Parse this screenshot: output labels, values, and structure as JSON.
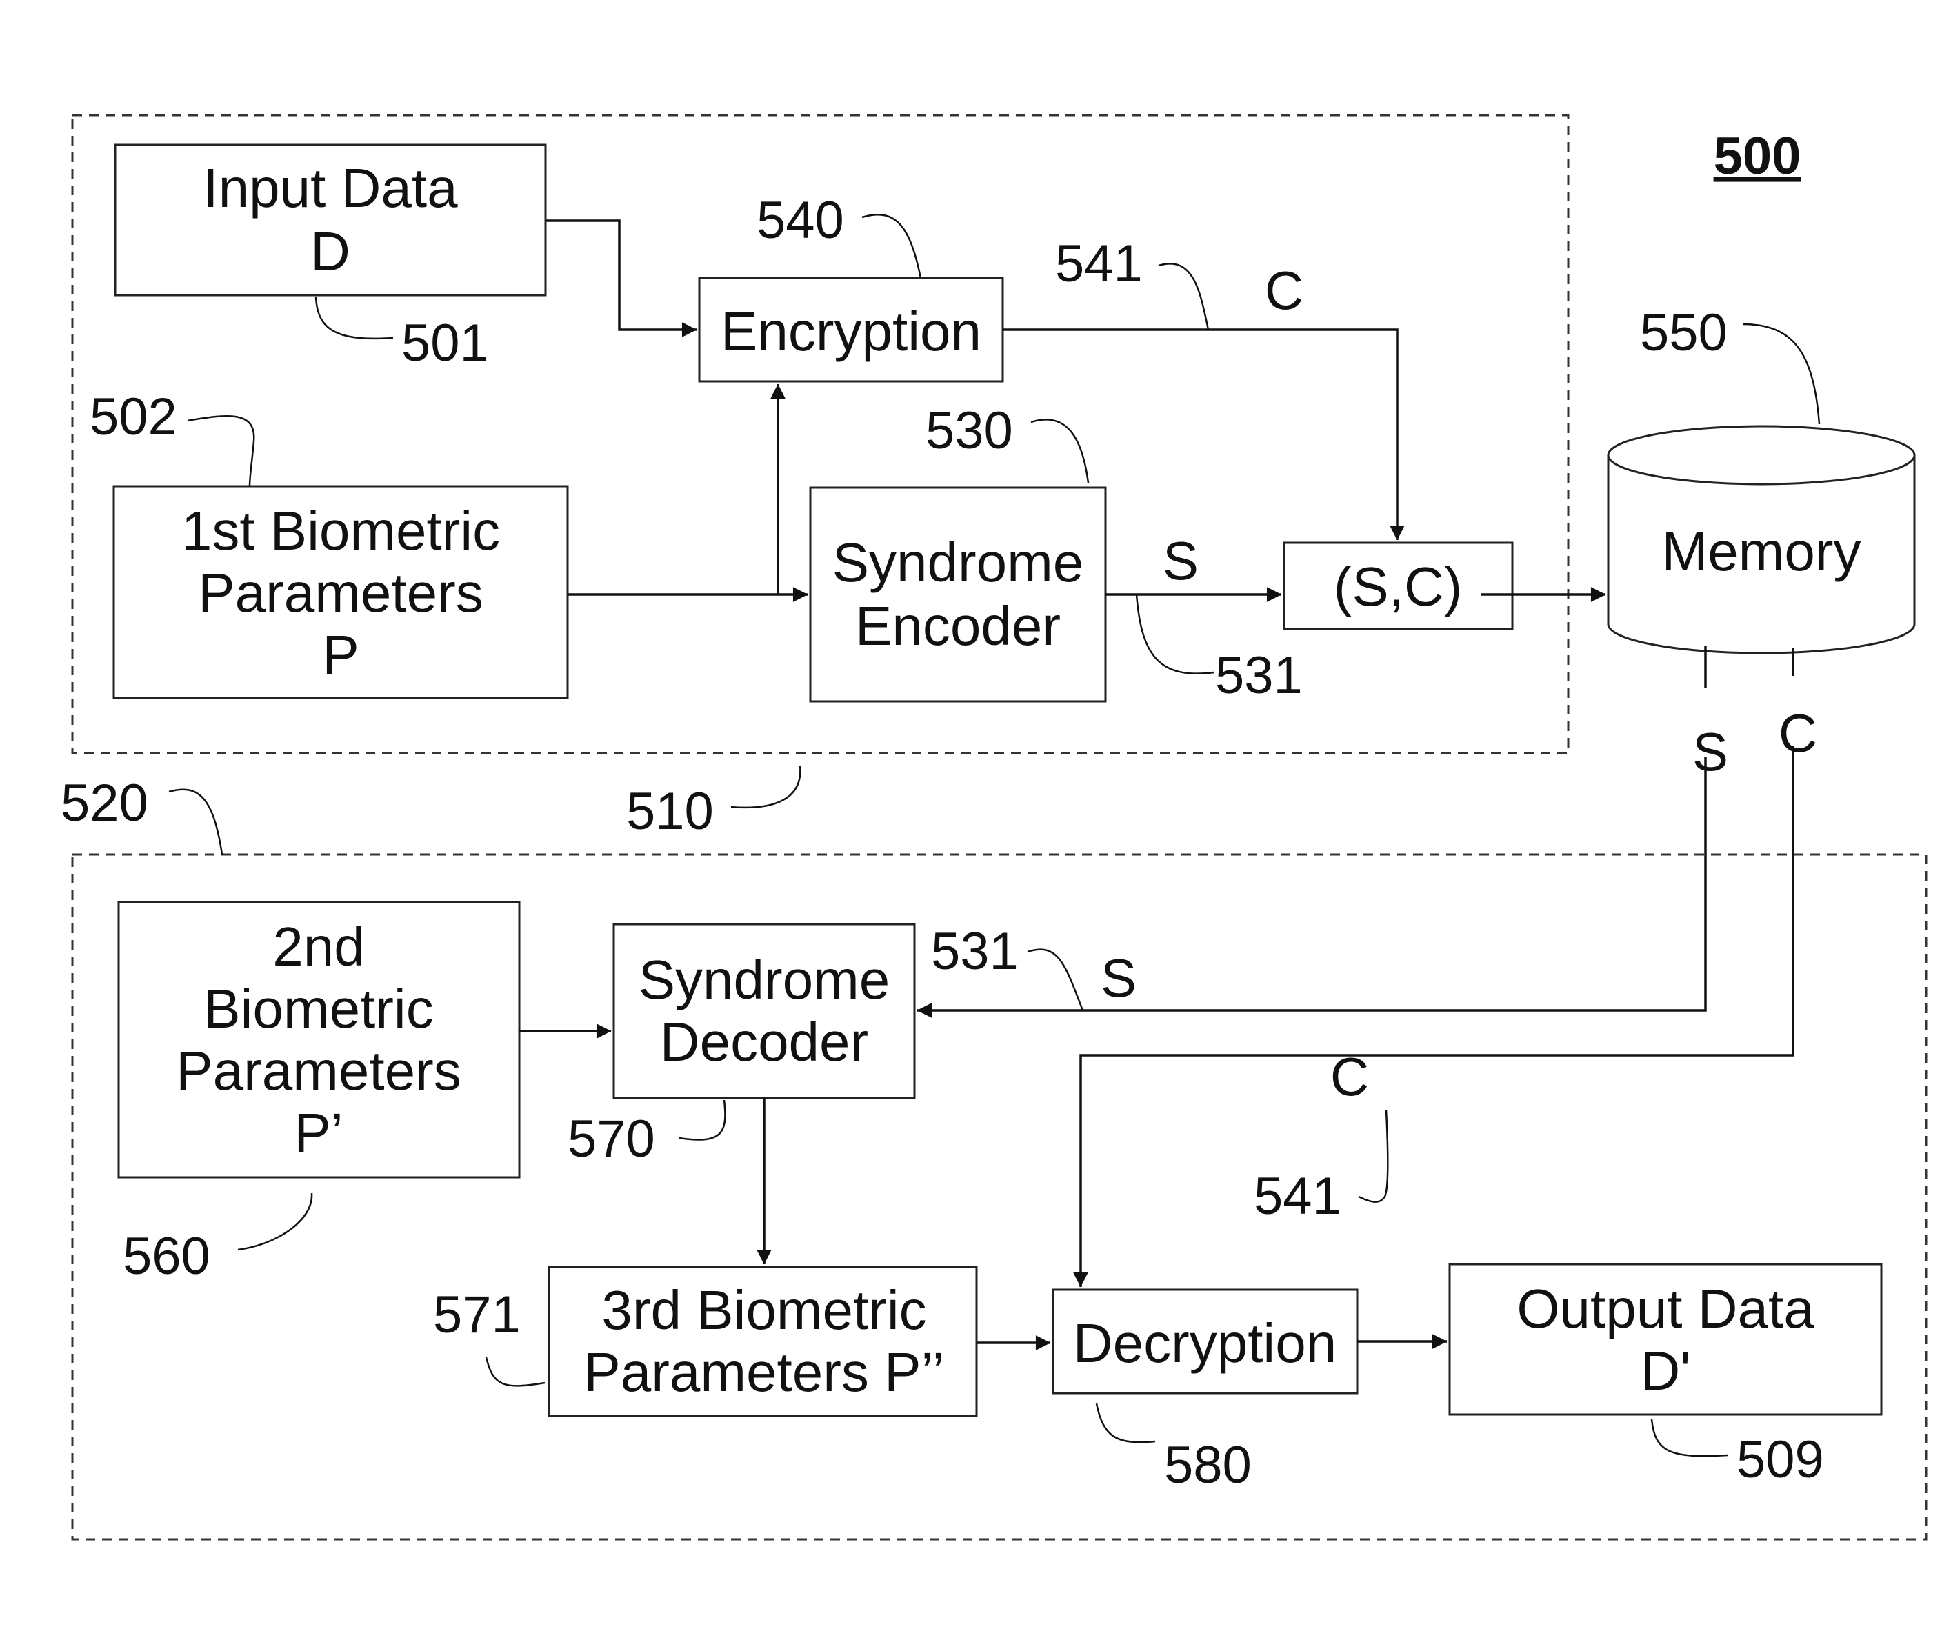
{
  "figure_number": "500",
  "groups": {
    "encoder_group": {
      "ref": "510"
    },
    "decoder_group": {
      "ref": "520"
    }
  },
  "blocks": {
    "input_data": {
      "lines": [
        "Input Data",
        "D"
      ],
      "ref": "501"
    },
    "first_biometric": {
      "lines": [
        "1st Biometric",
        "Parameters",
        "P"
      ],
      "ref": "502"
    },
    "encryption": {
      "lines": [
        "Encryption"
      ],
      "ref": "540"
    },
    "syndrome_encoder": {
      "lines": [
        "Syndrome",
        "Encoder"
      ],
      "ref": "530"
    },
    "sc_pair": {
      "lines": [
        "(S,C)"
      ]
    },
    "memory": {
      "lines": [
        "Memory"
      ],
      "ref": "550"
    },
    "second_biometric": {
      "lines": [
        "2nd",
        "Biometric",
        "Parameters",
        "P’"
      ],
      "ref": "560"
    },
    "syndrome_decoder": {
      "lines": [
        "Syndrome",
        "Decoder"
      ],
      "ref": "570"
    },
    "third_biometric": {
      "lines": [
        "3rd Biometric",
        "Parameters P’’"
      ],
      "ref": "571"
    },
    "decryption": {
      "lines": [
        "Decryption"
      ],
      "ref": "580"
    },
    "output_data": {
      "lines": [
        "Output Data",
        "D'"
      ],
      "ref": "509"
    }
  },
  "signals": {
    "ciphertext_top": {
      "label": "C",
      "ref": "541"
    },
    "syndrome_top": {
      "label": "S",
      "ref": "531"
    },
    "memory_s": {
      "label": "S"
    },
    "memory_c": {
      "label": "C"
    },
    "syndrome_bottom": {
      "label": "S",
      "ref": "531"
    },
    "ciphertext_bottom": {
      "label": "C",
      "ref": "541"
    }
  }
}
